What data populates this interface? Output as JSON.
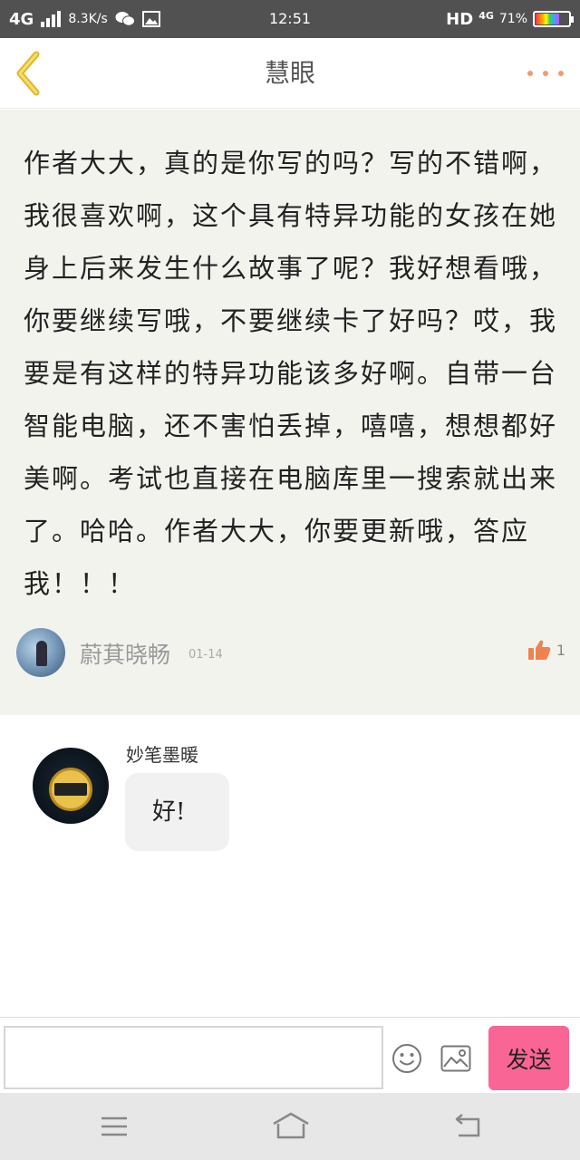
{
  "status_bar": {
    "network": "4G",
    "speed": "8.3K/s",
    "time": "12:51",
    "hd": "HD",
    "signal_type": "4G",
    "battery": "71%"
  },
  "header": {
    "title": "慧眼"
  },
  "post": {
    "text": "作者大大，真的是你写的吗？写的不错啊，我很喜欢啊，这个具有特异功能的女孩在她身上后来发生什么故事了呢？我好想看哦，你要继续写哦，不要继续卡了好吗？哎，我要是有这样的特异功能该多好啊。自带一台智能电脑，还不害怕丢掉，嘻嘻，想想都好美啊。考试也直接在电脑库里一搜索就出来了。哈哈。作者大大，你要更新哦，答应我！！！",
    "author": "蔚萁晓畅",
    "date": "01-14",
    "likes": "1"
  },
  "reply": {
    "name": "妙笔墨暖",
    "text": "好!"
  },
  "input_bar": {
    "placeholder": "",
    "send_label": "发送"
  },
  "colors": {
    "accent": "#f96595",
    "more_dots": "#f39b6b",
    "like": "#f0824f",
    "back_arrow": "#e0b72a"
  }
}
